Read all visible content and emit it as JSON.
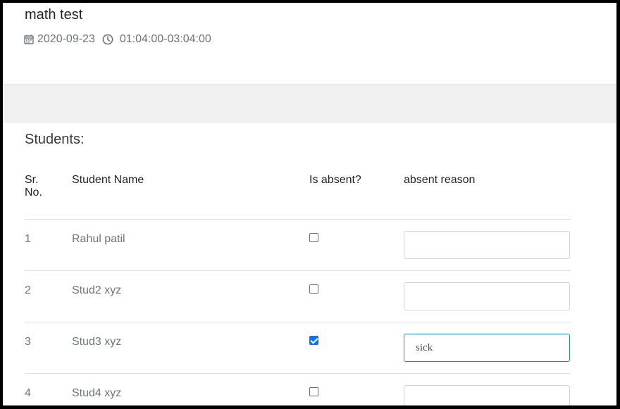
{
  "exam": {
    "title": "math test",
    "date": "2020-09-23",
    "time": "01:04:00-03:04:00"
  },
  "students_section": {
    "heading": "Students:",
    "columns": {
      "sr_line1": "Sr.",
      "sr_line2": "No.",
      "name": "Student Name",
      "absent": "Is absent?",
      "reason": "absent reason"
    },
    "rows": [
      {
        "sr": "1",
        "name": "Rahul patil",
        "absent": false,
        "reason": ""
      },
      {
        "sr": "2",
        "name": "Stud2 xyz",
        "absent": false,
        "reason": ""
      },
      {
        "sr": "3",
        "name": "Stud3 xyz",
        "absent": true,
        "reason": "sick"
      },
      {
        "sr": "4",
        "name": "Stud4 xyz",
        "absent": false,
        "reason": ""
      }
    ]
  },
  "colors": {
    "accent": "#0075ff",
    "focus_border": "#2a7ad0",
    "muted_text": "#6c757d",
    "band": "#f0f0f0"
  },
  "icons": {
    "date": "calendar-icon",
    "time": "clock-icon"
  }
}
